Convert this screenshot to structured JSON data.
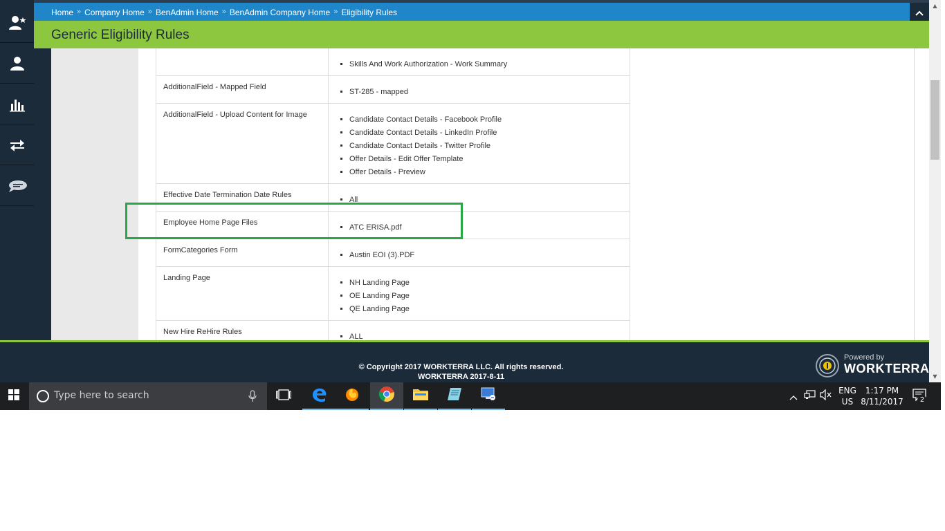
{
  "sidebar": {
    "items": [
      {
        "name": "user-star-icon"
      },
      {
        "name": "user-icon"
      },
      {
        "name": "bar-chart-icon"
      },
      {
        "name": "transfer-arrows-icon"
      },
      {
        "name": "chat-bubble-icon"
      }
    ]
  },
  "breadcrumb": {
    "items": [
      "Home",
      "Company Home",
      "BenAdmin Home",
      "BenAdmin Company Home"
    ],
    "current": "Eligibility Rules",
    "separator": "»"
  },
  "page": {
    "title": "Generic Eligibility Rules"
  },
  "rules_table": {
    "rows": [
      {
        "name": "",
        "values": [
          "Skills And Work Authorization - Work Summary"
        ]
      },
      {
        "name": "AdditionalField - Mapped Field",
        "values": [
          "ST-285 - mapped"
        ]
      },
      {
        "name": "AdditionalField - Upload Content for Image",
        "values": [
          "Candidate Contact Details - Facebook Profile",
          "Candidate Contact Details - LinkedIn Profile",
          "Candidate Contact Details - Twitter Profile",
          "Offer Details - Edit Offer Template",
          "Offer Details - Preview"
        ]
      },
      {
        "name": "Effective Date Termination Date Rules",
        "values": [
          "All"
        ]
      },
      {
        "name": "Employee Home Page Files",
        "values": [
          "ATC ERISA.pdf"
        ]
      },
      {
        "name": "FormCategories Form",
        "values": [
          "Austin EOI (3).PDF"
        ]
      },
      {
        "name": "Landing Page",
        "values": [
          "NH Landing Page",
          "OE Landing Page",
          "QE Landing Page"
        ]
      },
      {
        "name": "New Hire ReHire Rules",
        "values": [
          "ALL"
        ]
      }
    ]
  },
  "footer": {
    "copyright": "© Copyright 2017 WORKTERRA LLC. All rights reserved.",
    "version": "WORKTERRA 2017-8-11",
    "powered_by": "Powered by",
    "brand": "WORKTERRA"
  },
  "taskbar": {
    "search_placeholder": "Type here to search",
    "language_top": "ENG",
    "language_bottom": "US",
    "time": "1:17 PM",
    "date": "8/11/2017",
    "notification_count": "2"
  },
  "colors": {
    "header_blue": "#1f87c9",
    "title_green": "#8dc63f",
    "navy": "#1c2b3a",
    "highlight": "#27a745"
  }
}
